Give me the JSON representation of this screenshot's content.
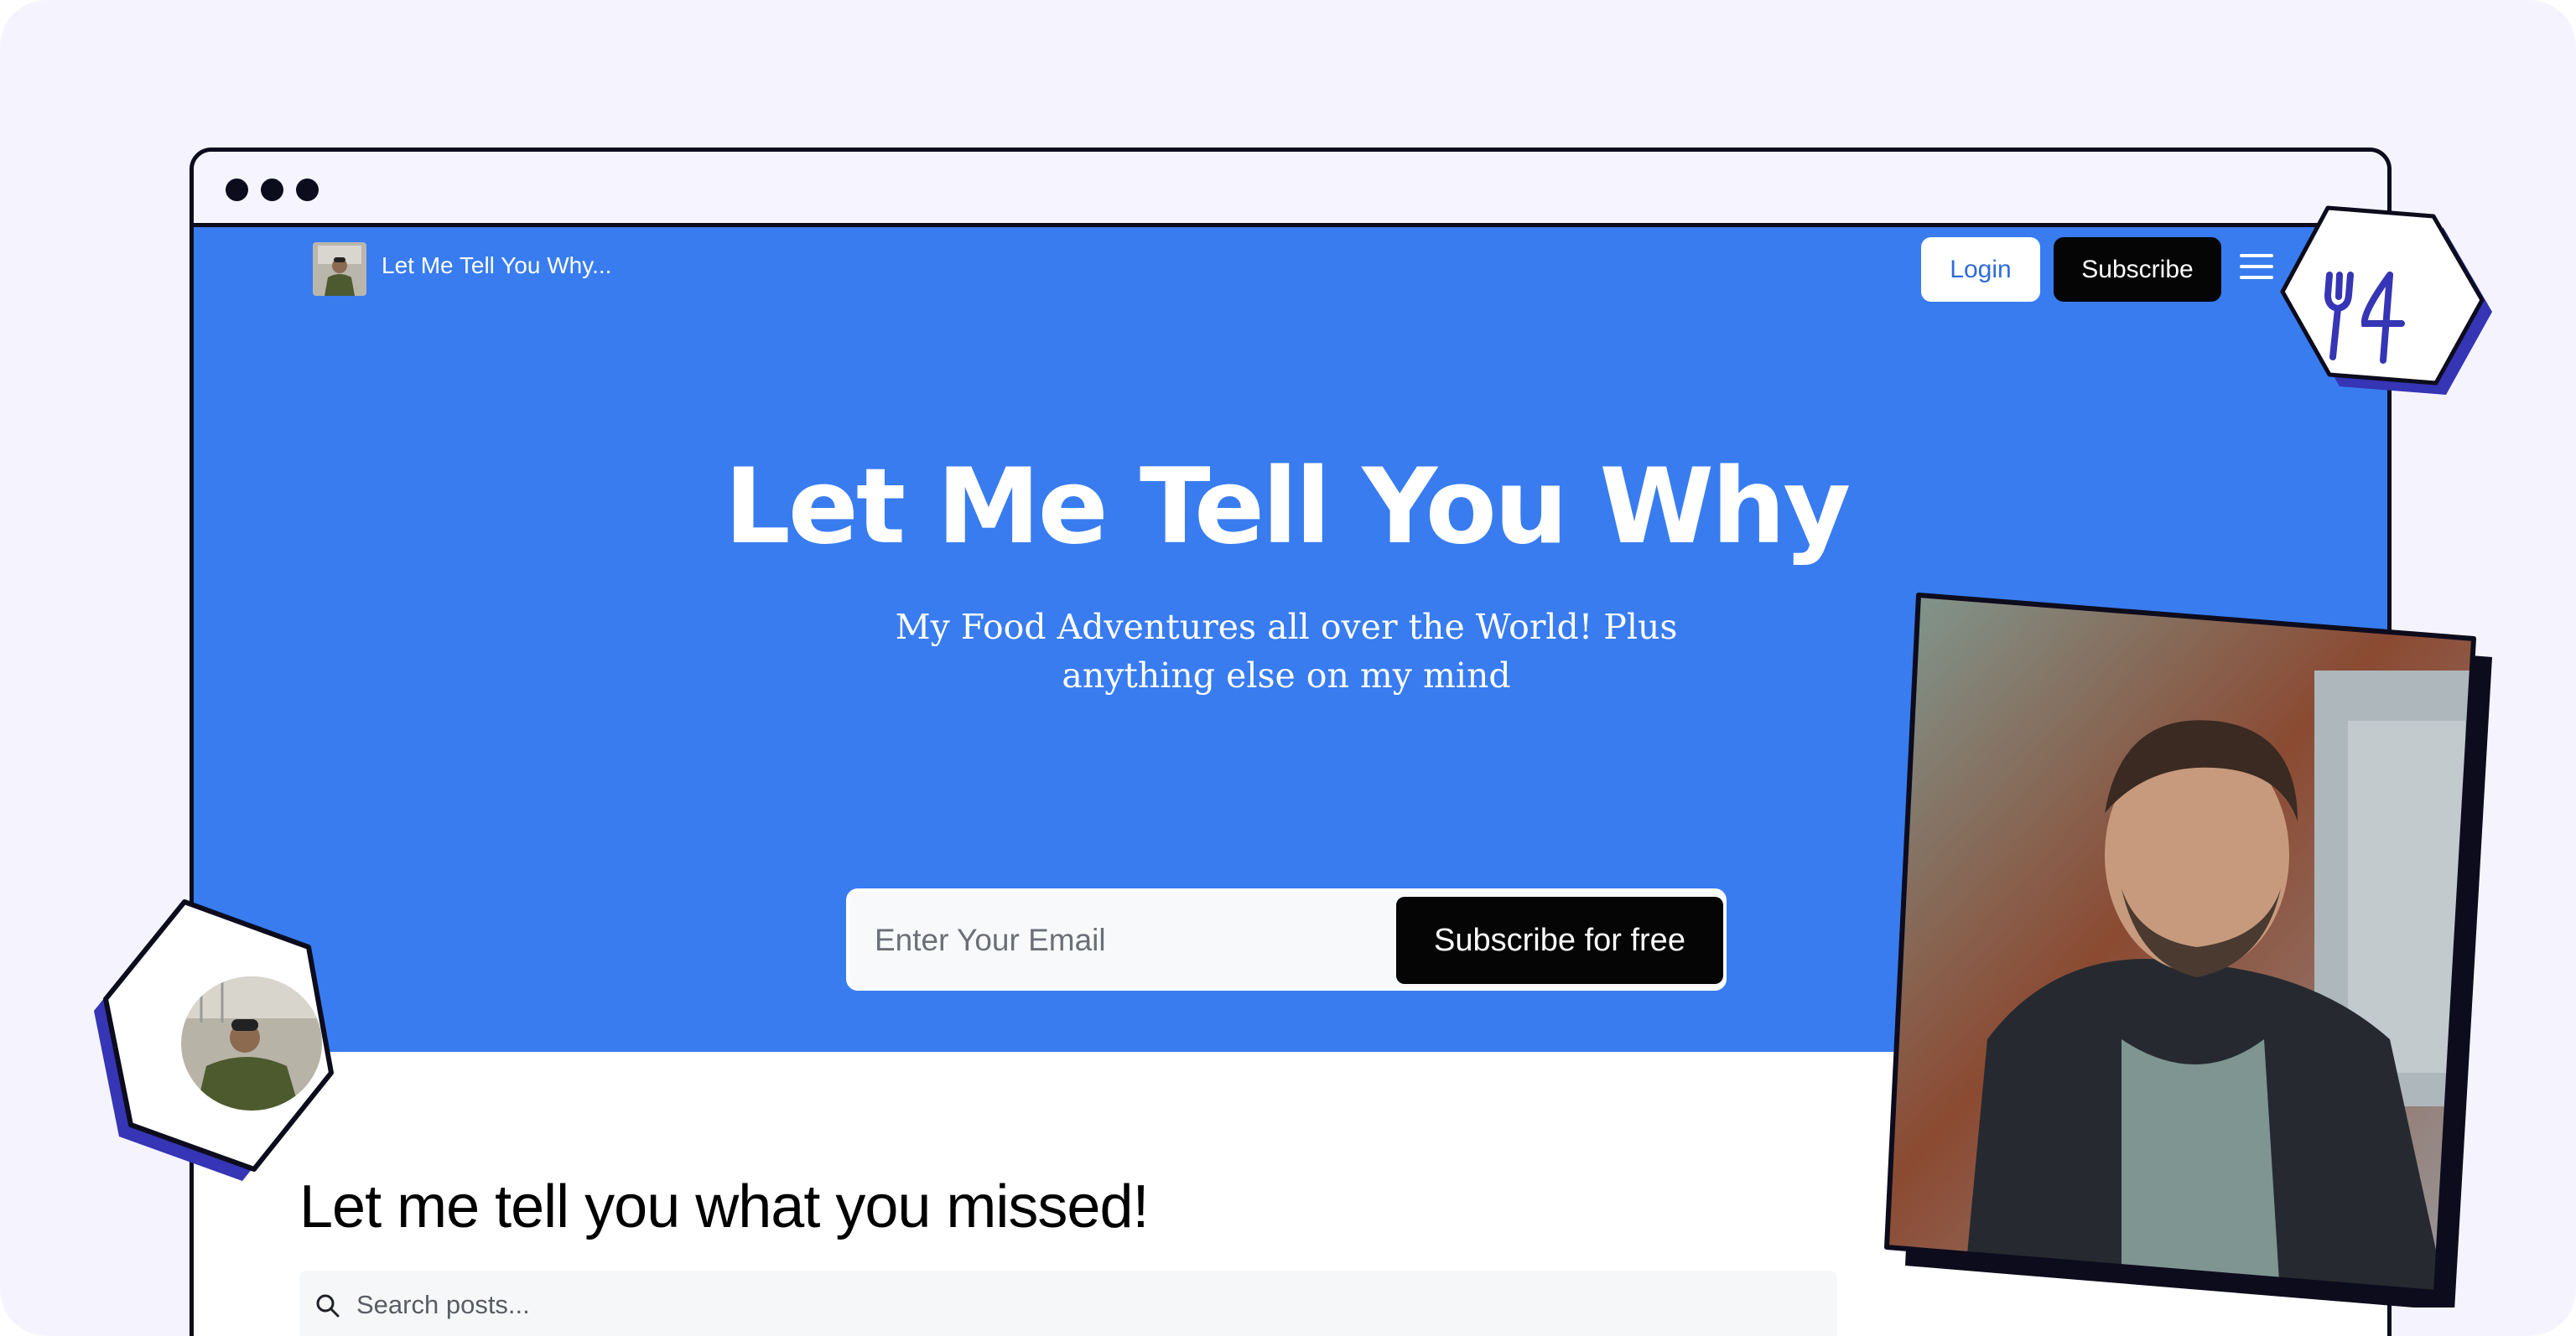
{
  "site": {
    "nav_title": "Let Me Tell You Why...",
    "login_label": "Login",
    "subscribe_label": "Subscribe"
  },
  "hero": {
    "title": "Let Me Tell You Why",
    "subtitle": "My Food Adventures all over the World! Plus anything else on my mind",
    "email_placeholder": "Enter Your Email",
    "subscribe_free_label": "Subscribe for free"
  },
  "posts": {
    "heading": "Let me tell you what you missed!",
    "search_placeholder": "Search posts..."
  },
  "colors": {
    "hero_blue": "#387cf0",
    "accent_indigo": "#3535b5",
    "frame_dark": "#0d0c1d",
    "page_background": "#f5f4fe"
  },
  "icons": [
    "menu-icon",
    "search-icon",
    "fork-knife-icon",
    "avatar-icon",
    "profile-photo"
  ]
}
